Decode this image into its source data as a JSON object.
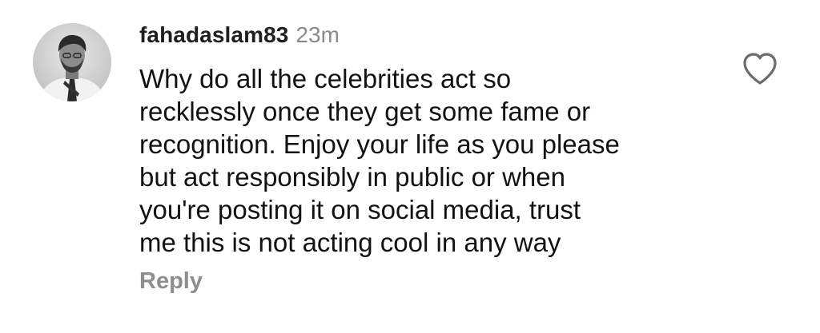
{
  "comment": {
    "username": "fahadaslam83",
    "timestamp": "23m",
    "text_lines": [
      "Why do all the celebrities act so",
      "recklessly once they get some fame or",
      "recognition. Enjoy your life as you please",
      "but act responsibly in public or when",
      "you're posting it on social media, trust",
      "me this is not acting cool in any way"
    ],
    "reply_label": "Reply",
    "avatar_icon": "user-avatar",
    "like_icon": "heart-outline-icon"
  },
  "colors": {
    "background": "#ffffff",
    "text": "#121212",
    "muted": "#8a8a8a"
  }
}
